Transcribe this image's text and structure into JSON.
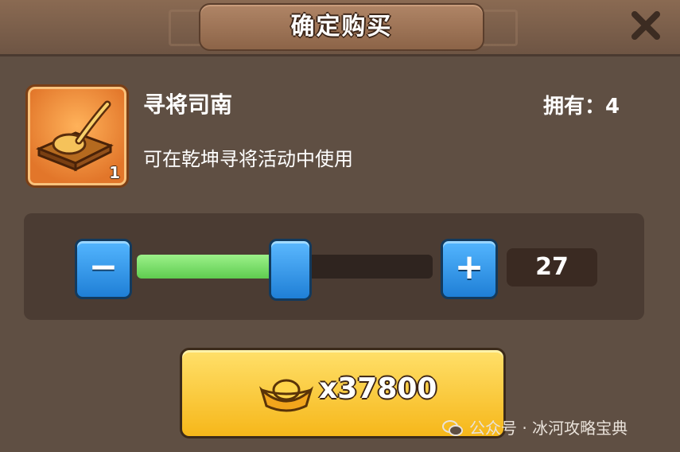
{
  "dialog": {
    "title": "确定购买",
    "close_icon": "close-icon"
  },
  "item": {
    "name": "寻将司南",
    "description": "可在乾坤寻将活动中使用",
    "icon": "compass-spoon-icon",
    "count": "1",
    "owned_label": "拥有：4"
  },
  "quantity": {
    "value": "27",
    "fill_fraction": 0.51,
    "minus_label": "−",
    "plus_label": "+"
  },
  "purchase": {
    "currency_icon": "gold-ingot-icon",
    "price": "x37800"
  },
  "watermark": {
    "text": "公众号 · 冰河攻略宝典"
  },
  "colors": {
    "panel": "#5f4f43",
    "slider_fill": "#6fd85c",
    "button_blue": "#2a8ee8",
    "buy_button": "#f8c531"
  }
}
